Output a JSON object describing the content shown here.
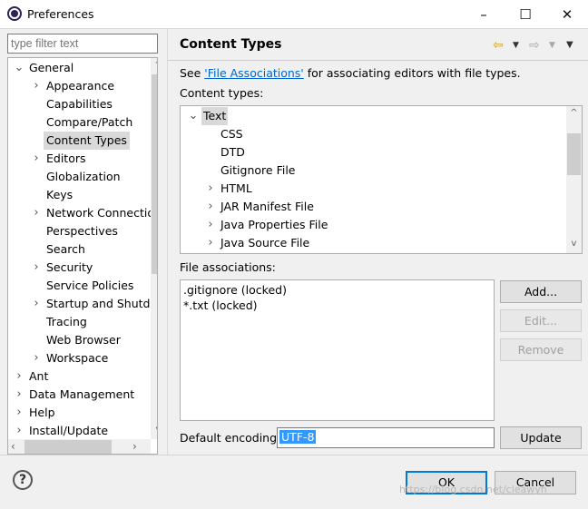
{
  "window": {
    "title": "Preferences",
    "controls": {
      "minimize": "–",
      "maximize": "☐",
      "close": "✕"
    }
  },
  "filter": {
    "placeholder": "type filter text"
  },
  "tree": {
    "items": [
      {
        "label": "General",
        "level": 0,
        "expanded": true
      },
      {
        "label": "Appearance",
        "level": 1,
        "expandable": true
      },
      {
        "label": "Capabilities",
        "level": 1
      },
      {
        "label": "Compare/Patch",
        "level": 1
      },
      {
        "label": "Content Types",
        "level": 1,
        "selected": true
      },
      {
        "label": "Editors",
        "level": 1,
        "expandable": true
      },
      {
        "label": "Globalization",
        "level": 1
      },
      {
        "label": "Keys",
        "level": 1
      },
      {
        "label": "Network Connections",
        "level": 1,
        "expandable": true
      },
      {
        "label": "Perspectives",
        "level": 1
      },
      {
        "label": "Search",
        "level": 1
      },
      {
        "label": "Security",
        "level": 1,
        "expandable": true
      },
      {
        "label": "Service Policies",
        "level": 1
      },
      {
        "label": "Startup and Shutdown",
        "level": 1,
        "expandable": true
      },
      {
        "label": "Tracing",
        "level": 1
      },
      {
        "label": "Web Browser",
        "level": 1
      },
      {
        "label": "Workspace",
        "level": 1,
        "expandable": true
      },
      {
        "label": "Ant",
        "level": 0,
        "expandable": true
      },
      {
        "label": "Data Management",
        "level": 0,
        "expandable": true
      },
      {
        "label": "Help",
        "level": 0,
        "expandable": true
      },
      {
        "label": "Install/Update",
        "level": 0,
        "expandable": true
      }
    ]
  },
  "page": {
    "title": "Content Types",
    "see_prefix": "See ",
    "link": "'File Associations'",
    "see_suffix": " for associating editors with file types.",
    "content_types_label": "Content types:",
    "file_assoc_label": "File associations:",
    "encoding_label": "Default encoding:",
    "encoding_value": "UTF-8"
  },
  "content_types": [
    {
      "label": "Text",
      "level": 0,
      "expanded": true,
      "selected": true
    },
    {
      "label": "CSS",
      "level": 1
    },
    {
      "label": "DTD",
      "level": 1
    },
    {
      "label": "Gitignore File",
      "level": 1
    },
    {
      "label": "HTML",
      "level": 1,
      "expandable": true
    },
    {
      "label": "JAR Manifest File",
      "level": 1,
      "expandable": true
    },
    {
      "label": "Java Properties File",
      "level": 1,
      "expandable": true
    },
    {
      "label": "Java Source File",
      "level": 1,
      "expandable": true
    }
  ],
  "file_associations": [
    ".gitignore (locked)",
    "*.txt (locked)"
  ],
  "buttons": {
    "add": "Add...",
    "edit": "Edit...",
    "remove": "Remove",
    "update": "Update",
    "ok": "OK",
    "cancel": "Cancel"
  },
  "watermark": "https://blog.csdn.net/cleawyh"
}
